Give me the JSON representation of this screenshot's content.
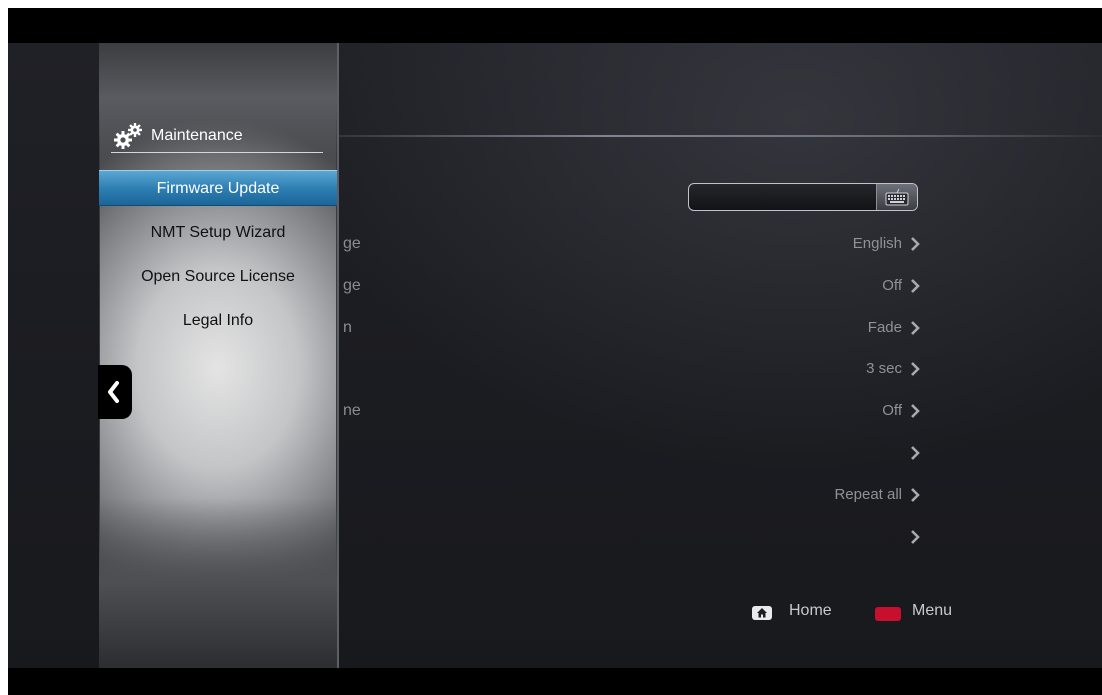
{
  "panel": {
    "title": "Maintenance",
    "items": [
      {
        "label": "Firmware Update",
        "selected": true
      },
      {
        "label": "NMT Setup Wizard",
        "selected": false
      },
      {
        "label": "Open Source License",
        "selected": false
      },
      {
        "label": "Legal Info",
        "selected": false
      }
    ]
  },
  "settings": {
    "rows": [
      {
        "label_fragment": "ge",
        "value": "English"
      },
      {
        "label_fragment": "ge",
        "value": "Off"
      },
      {
        "label_fragment": "n",
        "value": "Fade"
      },
      {
        "label_fragment": "",
        "value": "3 sec"
      },
      {
        "label_fragment": "ne",
        "value": "Off"
      },
      {
        "label_fragment": "",
        "value": ""
      },
      {
        "label_fragment": "",
        "value": "Repeat all"
      },
      {
        "label_fragment": "",
        "value": ""
      }
    ]
  },
  "legend": {
    "home_label": "Home",
    "menu_label": "Menu"
  },
  "icons": {
    "panel_title_icon": "gears-icon",
    "keyboard": "keyboard-icon",
    "back": "chevron-left-icon",
    "row_arrow": "chevron-right-icon",
    "home_key": "home-key-icon",
    "red_key": "red-key-icon"
  },
  "colors": {
    "selected_item": "#2e7fb3",
    "red_key": "#c8102e"
  }
}
